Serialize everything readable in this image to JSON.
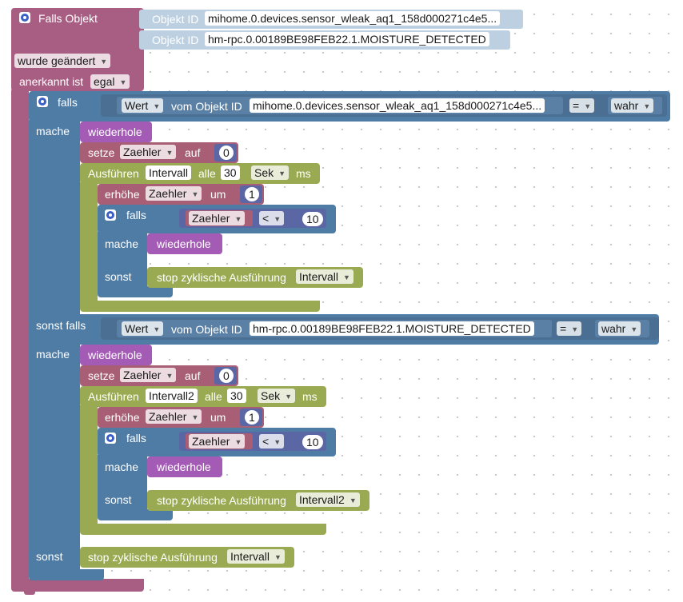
{
  "event": {
    "title": "Falls Objekt",
    "object_label_1": "Objekt ID",
    "object_value_1": "mihome.0.devices.sensor_wleak_aq1_158d000271c4e5...",
    "object_label_2": "Objekt ID",
    "object_value_2": "hm-rpc.0.00189BE98FEB22.1.MOISTURE_DETECTED",
    "changed_option": "wurde geändert",
    "ack_label": "anerkannt ist",
    "ack_option": "egal"
  },
  "if_block": {
    "falls_label": "falls",
    "mache_label": "mache",
    "sonst_falls_label": "sonst falls",
    "sonst_label": "sonst",
    "condition1": {
      "value_option": "Wert",
      "from_label": "vom Objekt ID",
      "object": "mihome.0.devices.sensor_wleak_aq1_158d000271c4e5...",
      "operator": "=",
      "compare": "wahr"
    },
    "condition2": {
      "value_option": "Wert",
      "from_label": "vom Objekt ID",
      "object": "hm-rpc.0.00189BE98FEB22.1.MOISTURE_DETECTED",
      "operator": "=",
      "compare": "wahr"
    }
  },
  "branch1": {
    "repeat_label": "wiederhole",
    "set_label": "setze",
    "set_var": "Zaehler",
    "set_to_label": "auf",
    "set_value": "0",
    "exec_label": "Ausführen",
    "interval_name": "Intervall",
    "every_label": "alle",
    "every_value": "30",
    "unit_option": "Sek",
    "ms_label": "ms",
    "inc_label": "erhöhe",
    "inc_var": "Zaehler",
    "inc_by_label": "um",
    "inc_value": "1",
    "inner_if_label": "falls",
    "compare_var": "Zaehler",
    "compare_op": "<",
    "compare_value": "10",
    "inner_mache": "mache",
    "inner_repeat": "wiederhole",
    "inner_sonst": "sonst",
    "stop_label": "stop zyklische Ausführung",
    "stop_interval": "Intervall"
  },
  "branch2": {
    "repeat_label": "wiederhole",
    "set_label": "setze",
    "set_var": "Zaehler",
    "set_to_label": "auf",
    "set_value": "0",
    "exec_label": "Ausführen",
    "interval_name": "Intervall2",
    "every_label": "alle",
    "every_value": "30",
    "unit_option": "Sek",
    "ms_label": "ms",
    "inc_label": "erhöhe",
    "inc_var": "Zaehler",
    "inc_by_label": "um",
    "inc_value": "1",
    "inner_if_label": "falls",
    "compare_var": "Zaehler",
    "compare_op": "<",
    "compare_value": "10",
    "inner_mache": "mache",
    "inner_repeat": "wiederhole",
    "inner_sonst": "sonst",
    "stop_label": "stop zyklische Ausführung",
    "stop_interval": "Intervall2"
  },
  "else_branch": {
    "stop_label": "stop zyklische Ausführung",
    "stop_interval": "Intervall"
  },
  "colors": {
    "event": "#a85e82",
    "control": "#4e7ca5",
    "loop": "#a45bb5",
    "variable": "#a85e74",
    "timer": "#9aaa52",
    "logic": "#5b80a5",
    "math": "#5b67a5"
  },
  "icons": {
    "gear": "gear-icon",
    "dropdown": "chevron-down-icon"
  }
}
